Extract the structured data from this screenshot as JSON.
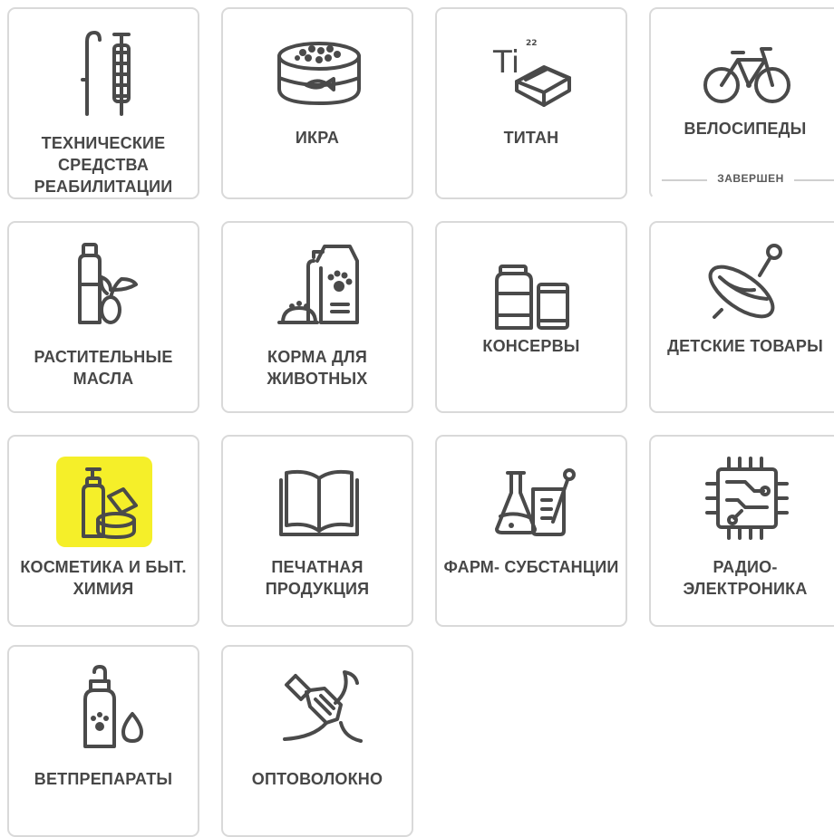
{
  "categories": [
    {
      "label": "ТЕХНИЧЕСКИЕ СРЕДСТВА РЕАБИЛИТАЦИИ",
      "icon": "crutches-icon"
    },
    {
      "label": "ИКРА",
      "icon": "caviar-can-icon"
    },
    {
      "label": "ТИТАН",
      "icon": "titanium-ingots-icon",
      "element_symbol": "Ti",
      "element_number": "22"
    },
    {
      "label": "ВЕЛОСИПЕДЫ",
      "icon": "bicycle-icon",
      "status": "ЗАВЕРШЕН"
    },
    {
      "label": "РАСТИТЕЛЬНЫЕ МАСЛА",
      "icon": "olive-oil-icon"
    },
    {
      "label": "КОРМА ДЛЯ ЖИВОТНЫХ",
      "icon": "pet-food-icon"
    },
    {
      "label": "КОНСЕРВЫ",
      "icon": "canned-goods-icon"
    },
    {
      "label": "ДЕТСКИЕ ТОВАРЫ",
      "icon": "spinning-top-icon"
    },
    {
      "label": "КОСМЕТИКА И БЫТ. ХИМИЯ",
      "icon": "cosmetics-icon",
      "highlight_color": "#f5ef29"
    },
    {
      "label": "ПЕЧАТНАЯ ПРОДУКЦИЯ",
      "icon": "open-book-icon"
    },
    {
      "label": "ФАРМ- СУБСТАНЦИИ",
      "icon": "lab-flasks-icon"
    },
    {
      "label": "РАДИО- ЭЛЕКТРОНИКА",
      "icon": "microchip-icon"
    },
    {
      "label": "ВЕТПРЕПАРАТЫ",
      "icon": "vet-medicine-icon"
    },
    {
      "label": "ОПТОВОЛОКНО",
      "icon": "fiber-optic-icon"
    }
  ],
  "colors": {
    "text": "#474747",
    "border": "#d9d9d9",
    "icon": "#4a4a4a",
    "highlight": "#f5ef29"
  }
}
